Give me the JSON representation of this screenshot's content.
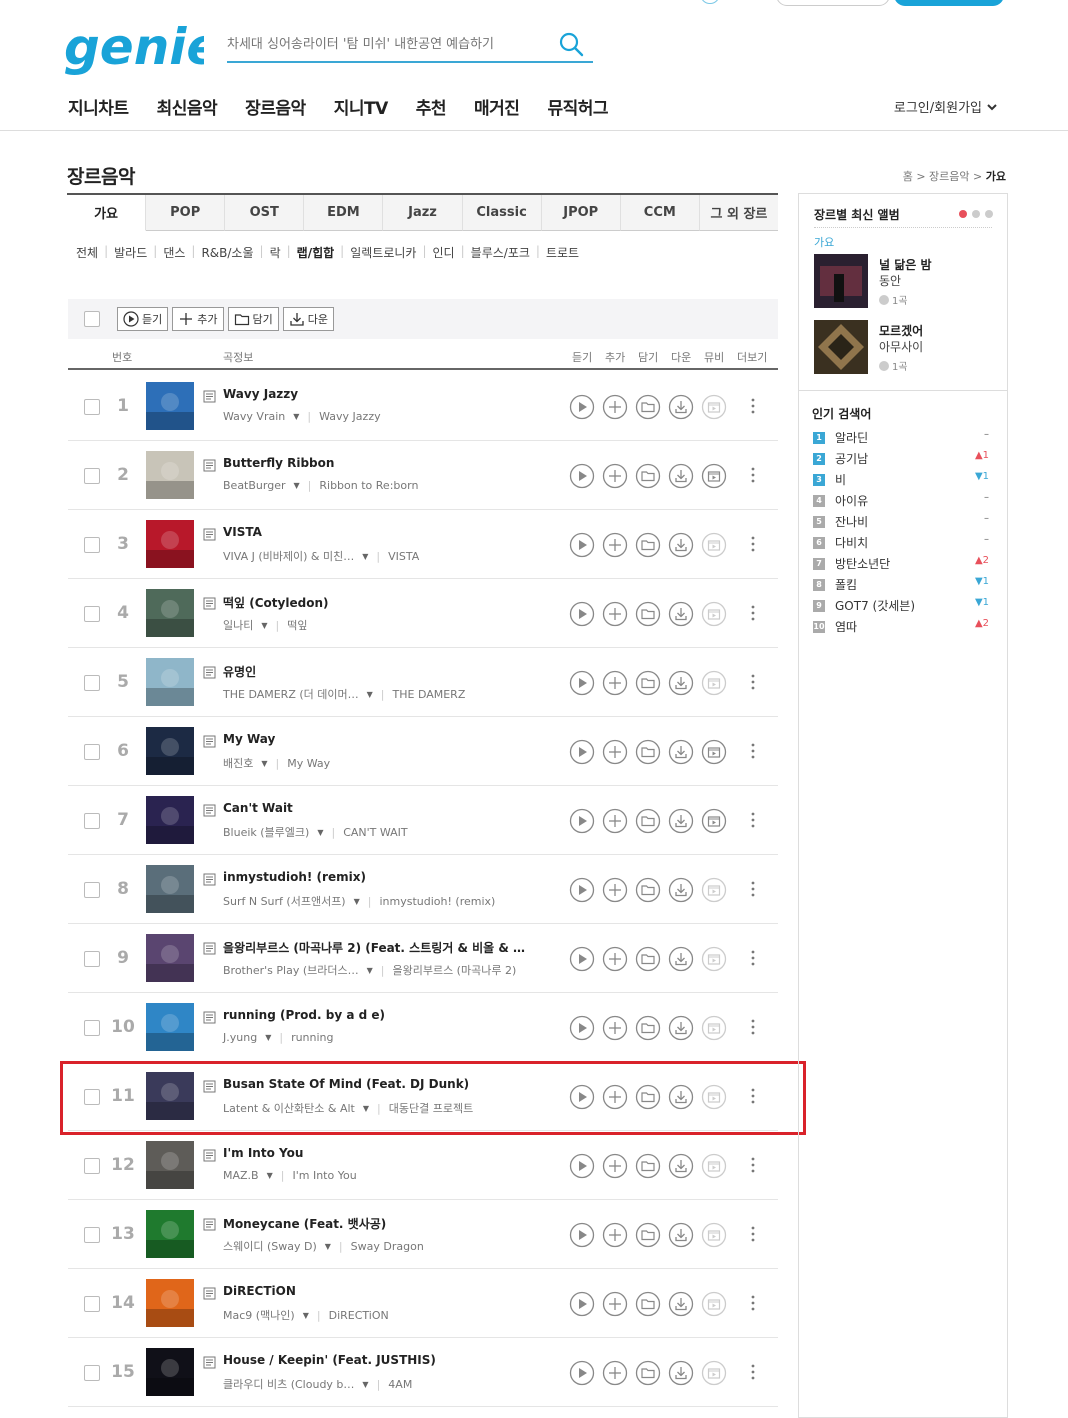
{
  "header": {
    "logo_text": "genie",
    "search_placeholder": "차세대 싱어송라이터 '탐 미쉬' 내한공연 예습하기",
    "nav": [
      "지니차트",
      "최신음악",
      "장르음악",
      "지니TV",
      "추천",
      "매거진",
      "뮤직허그"
    ],
    "login_label": "로그인/회원가입"
  },
  "page": {
    "title": "장르음악",
    "breadcrumb": [
      "홈",
      "장르음악",
      "가요"
    ]
  },
  "genre_tabs": [
    "가요",
    "POP",
    "OST",
    "EDM",
    "Jazz",
    "Classic",
    "JPOP",
    "CCM",
    "그 외 장르"
  ],
  "active_genre_tab": 0,
  "sub_genres": [
    "전체",
    "발라드",
    "댄스",
    "R&B/소울",
    "락",
    "랩/힙합",
    "일렉트로니카",
    "인디",
    "블루스/포크",
    "트로트"
  ],
  "active_sub_genre": 5,
  "toolbar": {
    "listen": "듣기",
    "add": "추가",
    "save": "담기",
    "download": "다운"
  },
  "columns": {
    "number": "번호",
    "info": "곡정보",
    "listen": "듣기",
    "add": "추가",
    "save": "담기",
    "download": "다운",
    "video": "뮤비",
    "more": "더보기"
  },
  "songs": [
    {
      "num": "1",
      "title": "Wavy Jazzy",
      "artist": "Wavy Vrain",
      "album": "Wavy Jazzy",
      "mv": false,
      "cover": "#2d6fb8"
    },
    {
      "num": "2",
      "title": "Butterfly Ribbon",
      "artist": "BeatBurger",
      "album": "Ribbon to Re:born",
      "mv": true,
      "cover": "#c8c4b8"
    },
    {
      "num": "3",
      "title": "VISTA",
      "artist": "VIVA J (비바제이) & 미친…",
      "album": "VISTA",
      "mv": false,
      "cover": "#b8182a"
    },
    {
      "num": "4",
      "title": "떡잎 (Cotyledon)",
      "artist": "일나티",
      "album": "떡잎",
      "mv": false,
      "cover": "#4f6a5a"
    },
    {
      "num": "5",
      "title": "유명인",
      "artist": "THE DAMERZ (더 데이머…",
      "album": "THE DAMERZ",
      "mv": false,
      "cover": "#8fb6c9"
    },
    {
      "num": "6",
      "title": "My Way",
      "artist": "배진호",
      "album": "My Way",
      "mv": true,
      "cover": "#1c2a44"
    },
    {
      "num": "7",
      "title": "Can't Wait",
      "artist": "Blueik (블루엘크)",
      "album": "CAN'T WAIT",
      "mv": true,
      "cover": "#2a2350"
    },
    {
      "num": "8",
      "title": "inmystudioh! (remix)",
      "artist": "Surf N Surf (서프앤서프)",
      "album": "inmystudioh! (remix)",
      "mv": false,
      "cover": "#5a6e7a"
    },
    {
      "num": "9",
      "title": "을왕리부르스 (마곡나루 2) (Feat. 스트링거 & 비올 & …",
      "artist": "Brother's Play (브라더스…",
      "album": "을왕리부르스 (마곡나루 2)",
      "mv": false,
      "cover": "#5a4570"
    },
    {
      "num": "10",
      "title": "running (Prod. by a d e)",
      "artist": "J.yung",
      "album": "running",
      "mv": false,
      "cover": "#2f86c6"
    },
    {
      "num": "11",
      "title": "Busan State Of Mind (Feat. DJ Dunk)",
      "artist": "Latent & 이산화탄소 & Alt",
      "album": "대동단결 프로젝트",
      "mv": false,
      "cover": "#3a3a5a"
    },
    {
      "num": "12",
      "title": "I'm Into You",
      "artist": "MAZ.B",
      "album": "I'm Into You",
      "mv": false,
      "cover": "#5e5c58"
    },
    {
      "num": "13",
      "title": "Moneycane (Feat. 뱃사공)",
      "artist": "스웨이디 (Sway D)",
      "album": "Sway Dragon",
      "mv": false,
      "cover": "#1f7a2e"
    },
    {
      "num": "14",
      "title": "DiRECTiON",
      "artist": "Mac9 (맥나인)",
      "album": "DiRECTiON",
      "mv": false,
      "cover": "#e0661a"
    },
    {
      "num": "15",
      "title": "House / Keepin' (Feat. JUSTHIS)",
      "artist": "클라우디 비츠 (Cloudy b…",
      "album": "4AM",
      "mv": false,
      "cover": "#101018"
    }
  ],
  "sidebar": {
    "latest_title": "장르별 최신 앨범",
    "latest_genre": "가요",
    "albums": [
      {
        "title": "널 닮은 밤",
        "artist": "동안",
        "count": "1곡",
        "cover": "#2a2030"
      },
      {
        "title": "모르겠어",
        "artist": "아무사이",
        "count": "1곡",
        "cover": "#6a5a3a"
      }
    ],
    "popular_title": "인기 검색어",
    "popular": [
      {
        "rank": "1",
        "keyword": "알라딘",
        "change": "–",
        "dir": "same"
      },
      {
        "rank": "2",
        "keyword": "공기남",
        "change": "▲1",
        "dir": "up"
      },
      {
        "rank": "3",
        "keyword": "비",
        "change": "▼1",
        "dir": "down"
      },
      {
        "rank": "4",
        "keyword": "아이유",
        "change": "–",
        "dir": "same"
      },
      {
        "rank": "5",
        "keyword": "잔나비",
        "change": "–",
        "dir": "same"
      },
      {
        "rank": "6",
        "keyword": "다비치",
        "change": "–",
        "dir": "same"
      },
      {
        "rank": "7",
        "keyword": "방탄소년단",
        "change": "▲2",
        "dir": "up"
      },
      {
        "rank": "8",
        "keyword": "폴킴",
        "change": "▼1",
        "dir": "down"
      },
      {
        "rank": "9",
        "keyword": "GOT7 (갓세븐)",
        "change": "▼1",
        "dir": "down"
      },
      {
        "rank": "10",
        "keyword": "염따",
        "change": "▲2",
        "dir": "up"
      }
    ]
  },
  "colors": {
    "brand": "#19a3d8",
    "highlight_box": "#d9222a",
    "rank_top": "#3aa7d5",
    "rank_rest": "#aaaaaa"
  }
}
